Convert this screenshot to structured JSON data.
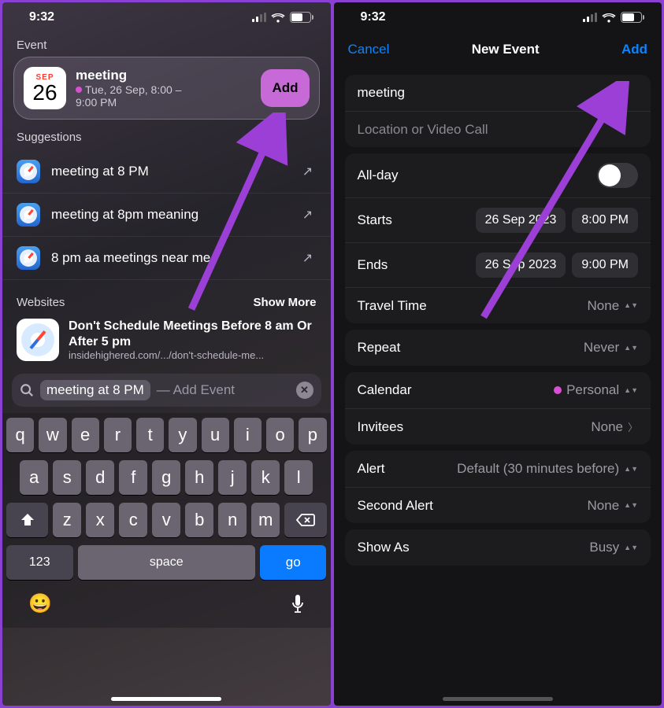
{
  "status": {
    "time": "9:32",
    "battery": "65"
  },
  "left": {
    "section_event": "Event",
    "event": {
      "month": "SEP",
      "day": "26",
      "title": "meeting",
      "sub1": "Tue, 26 Sep, 8:00 –",
      "sub2": "9:00 PM",
      "add": "Add"
    },
    "section_sugg": "Suggestions",
    "sugg": [
      "meeting at 8 PM",
      "meeting at 8pm meaning",
      "8 pm aa meetings near me"
    ],
    "section_web": "Websites",
    "show_more": "Show More",
    "web_title": "Don't Schedule Meetings Before 8 am Or After 5 pm",
    "web_url": "insidehighered.com/.../don't-schedule-me...",
    "search": {
      "query": "meeting at 8 PM",
      "hint": "— Add Event"
    },
    "keys": {
      "r1": [
        "q",
        "w",
        "e",
        "r",
        "t",
        "y",
        "u",
        "i",
        "o",
        "p"
      ],
      "r2": [
        "a",
        "s",
        "d",
        "f",
        "g",
        "h",
        "j",
        "k",
        "l"
      ],
      "r3": [
        "z",
        "x",
        "c",
        "v",
        "b",
        "n",
        "m"
      ],
      "num": "123",
      "space": "space",
      "go": "go"
    }
  },
  "right": {
    "cancel": "Cancel",
    "title": "New Event",
    "add": "Add",
    "name": "meeting",
    "location_ph": "Location or Video Call",
    "allday": "All-day",
    "starts": "Starts",
    "start_date": "26 Sep 2023",
    "start_time": "8:00 PM",
    "ends": "Ends",
    "end_date": "26 Sep 2023",
    "end_time": "9:00 PM",
    "travel": "Travel Time",
    "travel_val": "None",
    "repeat": "Repeat",
    "repeat_val": "Never",
    "calendar": "Calendar",
    "calendar_val": "Personal",
    "invitees": "Invitees",
    "invitees_val": "None",
    "alert": "Alert",
    "alert_val": "Default (30 minutes before)",
    "alert2": "Second Alert",
    "alert2_val": "None",
    "showas": "Show As",
    "showas_val": "Busy"
  }
}
